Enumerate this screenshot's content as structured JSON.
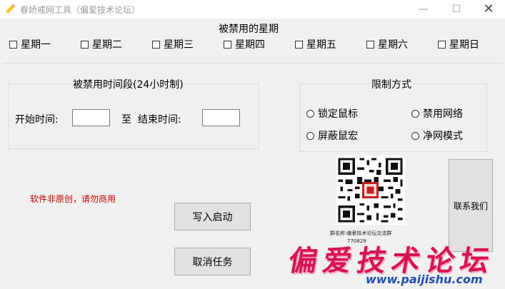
{
  "window": {
    "title": "春娇戒网工具（偏爱技术论坛）",
    "minimize_glyph": "—",
    "maximize_glyph": "☐",
    "close_glyph": "✕"
  },
  "weekdays": {
    "title": "被禁用的星期",
    "days": [
      "星期一",
      "星期二",
      "星期三",
      "星期四",
      "星期五",
      "星期六",
      "星期日"
    ]
  },
  "time_range": {
    "title": "被禁用时间段(24小时制)",
    "start_label": "开始时间:",
    "to_label": "至",
    "end_label": "结束时间:",
    "start_value": "",
    "end_value": ""
  },
  "restriction": {
    "title": "限制方式",
    "options": [
      "锁定鼠标",
      "禁用网络",
      "屏蔽鼠宏",
      "净网模式"
    ]
  },
  "notice": "软件非原创，请勿商用",
  "buttons": {
    "write_startup": "写入启动",
    "cancel_task": "取消任务",
    "contact": "联系我们"
  },
  "qr": {
    "caption": "群名称:偏爱技术论坛交流群",
    "caption2": "770829"
  },
  "watermark": {
    "text": "偏爱技术论坛",
    "url": "www.paijishu.com"
  },
  "colors": {
    "notice": "#c00000",
    "watermark": "#d6154f",
    "url": "#2050b0"
  }
}
